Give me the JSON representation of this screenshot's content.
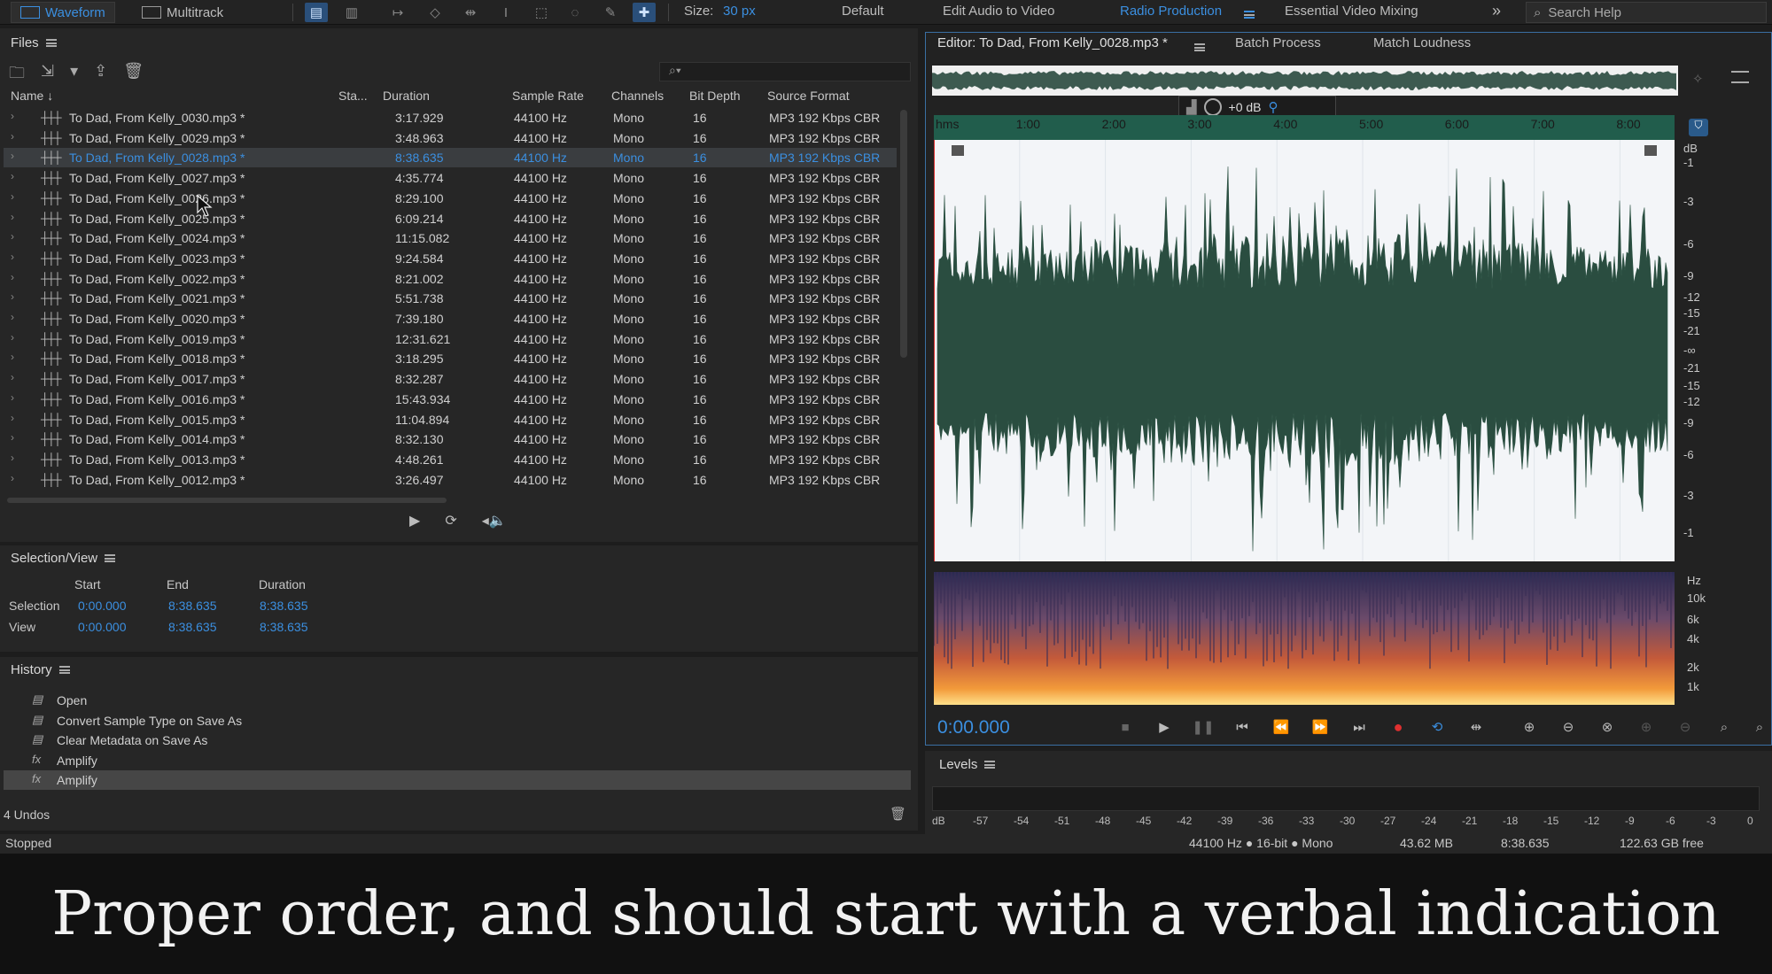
{
  "toolbar": {
    "waveform": "Waveform",
    "multitrack": "Multitrack",
    "size_label": "Size:",
    "size_value": "30 px",
    "workspaces": [
      "Default",
      "Edit Audio to Video",
      "Radio Production",
      "Essential Video Mixing"
    ],
    "current_workspace": "Radio Production",
    "search_placeholder": "Search Help"
  },
  "files": {
    "title": "Files",
    "columns": [
      "Name",
      "Sta...",
      "Duration",
      "Sample Rate",
      "Channels",
      "Bit Depth",
      "Source Format"
    ],
    "rows": [
      {
        "name": "To Dad, From Kelly_0030.mp3 *",
        "duration": "3:17.929",
        "rate": "44100 Hz",
        "channels": "Mono",
        "bits": "16",
        "format": "MP3 192 Kbps CBR"
      },
      {
        "name": "To Dad, From Kelly_0029.mp3 *",
        "duration": "3:48.963",
        "rate": "44100 Hz",
        "channels": "Mono",
        "bits": "16",
        "format": "MP3 192 Kbps CBR"
      },
      {
        "name": "To Dad, From Kelly_0028.mp3 *",
        "duration": "8:38.635",
        "rate": "44100 Hz",
        "channels": "Mono",
        "bits": "16",
        "format": "MP3 192 Kbps CBR",
        "selected": true
      },
      {
        "name": "To Dad, From Kelly_0027.mp3 *",
        "duration": "4:35.774",
        "rate": "44100 Hz",
        "channels": "Mono",
        "bits": "16",
        "format": "MP3 192 Kbps CBR"
      },
      {
        "name": "To Dad, From Kelly_0026.mp3 *",
        "duration": "8:29.100",
        "rate": "44100 Hz",
        "channels": "Mono",
        "bits": "16",
        "format": "MP3 192 Kbps CBR"
      },
      {
        "name": "To Dad, From Kelly_0025.mp3 *",
        "duration": "6:09.214",
        "rate": "44100 Hz",
        "channels": "Mono",
        "bits": "16",
        "format": "MP3 192 Kbps CBR"
      },
      {
        "name": "To Dad, From Kelly_0024.mp3 *",
        "duration": "11:15.082",
        "rate": "44100 Hz",
        "channels": "Mono",
        "bits": "16",
        "format": "MP3 192 Kbps CBR"
      },
      {
        "name": "To Dad, From Kelly_0023.mp3 *",
        "duration": "9:24.584",
        "rate": "44100 Hz",
        "channels": "Mono",
        "bits": "16",
        "format": "MP3 192 Kbps CBR"
      },
      {
        "name": "To Dad, From Kelly_0022.mp3 *",
        "duration": "8:21.002",
        "rate": "44100 Hz",
        "channels": "Mono",
        "bits": "16",
        "format": "MP3 192 Kbps CBR"
      },
      {
        "name": "To Dad, From Kelly_0021.mp3 *",
        "duration": "5:51.738",
        "rate": "44100 Hz",
        "channels": "Mono",
        "bits": "16",
        "format": "MP3 192 Kbps CBR"
      },
      {
        "name": "To Dad, From Kelly_0020.mp3 *",
        "duration": "7:39.180",
        "rate": "44100 Hz",
        "channels": "Mono",
        "bits": "16",
        "format": "MP3 192 Kbps CBR"
      },
      {
        "name": "To Dad, From Kelly_0019.mp3 *",
        "duration": "12:31.621",
        "rate": "44100 Hz",
        "channels": "Mono",
        "bits": "16",
        "format": "MP3 192 Kbps CBR"
      },
      {
        "name": "To Dad, From Kelly_0018.mp3 *",
        "duration": "3:18.295",
        "rate": "44100 Hz",
        "channels": "Mono",
        "bits": "16",
        "format": "MP3 192 Kbps CBR"
      },
      {
        "name": "To Dad, From Kelly_0017.mp3 *",
        "duration": "8:32.287",
        "rate": "44100 Hz",
        "channels": "Mono",
        "bits": "16",
        "format": "MP3 192 Kbps CBR"
      },
      {
        "name": "To Dad, From Kelly_0016.mp3 *",
        "duration": "15:43.934",
        "rate": "44100 Hz",
        "channels": "Mono",
        "bits": "16",
        "format": "MP3 192 Kbps CBR"
      },
      {
        "name": "To Dad, From Kelly_0015.mp3 *",
        "duration": "11:04.894",
        "rate": "44100 Hz",
        "channels": "Mono",
        "bits": "16",
        "format": "MP3 192 Kbps CBR"
      },
      {
        "name": "To Dad, From Kelly_0014.mp3 *",
        "duration": "8:32.130",
        "rate": "44100 Hz",
        "channels": "Mono",
        "bits": "16",
        "format": "MP3 192 Kbps CBR"
      },
      {
        "name": "To Dad, From Kelly_0013.mp3 *",
        "duration": "4:48.261",
        "rate": "44100 Hz",
        "channels": "Mono",
        "bits": "16",
        "format": "MP3 192 Kbps CBR"
      },
      {
        "name": "To Dad, From Kelly_0012.mp3 *",
        "duration": "3:26.497",
        "rate": "44100 Hz",
        "channels": "Mono",
        "bits": "16",
        "format": "MP3 192 Kbps CBR"
      }
    ]
  },
  "selection_view": {
    "title": "Selection/View",
    "headers": [
      "Start",
      "End",
      "Duration"
    ],
    "selection_label": "Selection",
    "view_label": "View",
    "selection": [
      "0:00.000",
      "8:38.635",
      "8:38.635"
    ],
    "view": [
      "0:00.000",
      "8:38.635",
      "8:38.635"
    ]
  },
  "history": {
    "title": "History",
    "items": [
      "Open",
      "Convert Sample Type on Save As",
      "Clear Metadata on Save As",
      "Amplify",
      "Amplify"
    ],
    "undos": "4 Undos"
  },
  "editor": {
    "tab_title": "Editor: To Dad, From Kelly_0028.mp3 *",
    "tabs": [
      "Batch Process",
      "Match Loudness"
    ],
    "hud_gain": "+0 dB",
    "ruler_labels": [
      "hms",
      "1:00",
      "2:00",
      "3:00",
      "4:00",
      "5:00",
      "6:00",
      "7:00",
      "8:00"
    ],
    "db_scale": [
      "dB",
      "-1",
      "-3",
      "-6",
      "-9",
      "-12",
      "-15",
      "-21",
      "-∞",
      "-21",
      "-15",
      "-12",
      "-9",
      "-6",
      "-3",
      "-1"
    ],
    "hz_scale": [
      "Hz",
      "10k",
      "6k",
      "4k",
      "2k",
      "1k"
    ],
    "time_display": "0:00.000"
  },
  "levels": {
    "title": "Levels",
    "scale": [
      "dB",
      "-57",
      "-54",
      "-51",
      "-48",
      "-45",
      "-42",
      "-39",
      "-36",
      "-33",
      "-30",
      "-27",
      "-24",
      "-21",
      "-18",
      "-15",
      "-12",
      "-9",
      "-6",
      "-3",
      "0"
    ]
  },
  "status": {
    "state": "Stopped",
    "format": "44100 Hz ● 16-bit ● Mono",
    "size": "43.62 MB",
    "duration": "8:38.635",
    "free": "122.63 GB free"
  },
  "caption": "Proper order, and should start with a verbal indication",
  "colors": {
    "accent": "#3b8fe0",
    "waveform": "#2a4d40",
    "ruler": "#215d4c",
    "record": "#e03030"
  }
}
